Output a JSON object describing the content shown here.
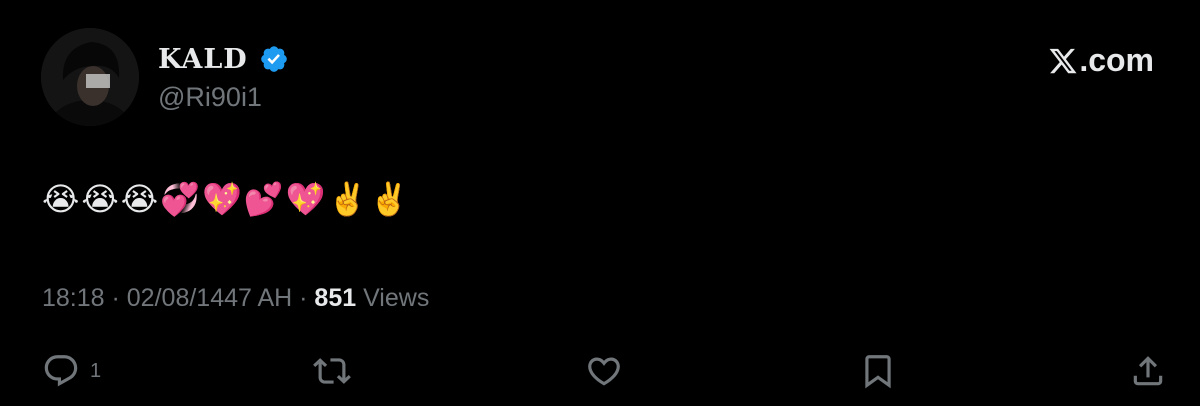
{
  "user": {
    "display_name": "KALD",
    "handle": "@Ri90i1",
    "verified": true
  },
  "brand": {
    "label": ".com",
    "mark": "x-logo-icon"
  },
  "tweet": {
    "text": "😭😭😭💞💖💕💖✌️✌️"
  },
  "meta": {
    "time": "18:18",
    "separator1": " · ",
    "date": "02/08/1447 AH",
    "separator2": " · ",
    "views_count": "851",
    "views_label": " Views"
  },
  "actions": {
    "reply_count": "1",
    "reply_icon": "reply-icon",
    "retweet_icon": "retweet-icon",
    "like_icon": "heart-icon",
    "bookmark_icon": "bookmark-icon",
    "share_icon": "share-icon"
  },
  "colors": {
    "background": "#000000",
    "text": "#e7e9ea",
    "muted": "#71767b",
    "verified": "#1d9bf0"
  }
}
